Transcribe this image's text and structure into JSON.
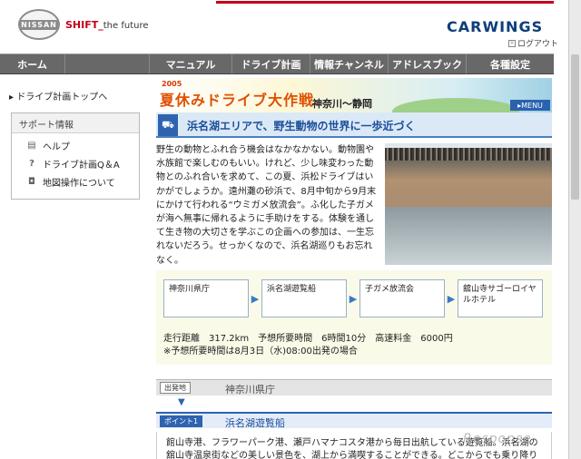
{
  "header": {
    "logo_text": "NISSAN",
    "tagline": "SHIFT_",
    "tagline_sub": "the future",
    "brand": "CARWINGS",
    "logout": "ログアウト",
    "accent_color": "#c4001a"
  },
  "nav": {
    "items": [
      "ホーム",
      "マニュアル",
      "ドライブ計画",
      "情報チャンネル",
      "アドレスブック",
      "各種設定"
    ]
  },
  "sidebar": {
    "top_link": "ドライブ計画トップへ",
    "support_title": "サポート情報",
    "support_items": [
      {
        "label": "ヘルプ",
        "icon": "document-icon"
      },
      {
        "label": "ドライブ計画Q＆A",
        "icon": "question-icon"
      },
      {
        "label": "地図操作について",
        "icon": "mouse-icon"
      }
    ]
  },
  "banner": {
    "year": "2005",
    "title": "夏休みドライブ大作戦",
    "route": "神奈川〜静岡",
    "menu": "MENU"
  },
  "section": {
    "heading": "浜名湖エリアで、野生動物の世界に一歩近づく",
    "body": "野生の動物とふれ合う機会はなかなかない。動物園や水族館で楽しむのもいい。けれど、少し味変わった動物とのふれ合いを求めて、この夏、浜松ドライブはいかがでしょうか。遠州灘の砂浜で、8月中旬から9月末にかけて行われる“ウミガメ放流会”。ふ化した子ガメが海へ無事に帰れるように手助けをする。体験を通して生き物の大切さを学ぶこの企画への参加は、一生忘れないだろう。せっかくなので、浜名湖巡りもお忘れなく。"
  },
  "route": {
    "stops": [
      "神奈川県庁",
      "浜名湖遊覧船",
      "子ガメ放流会",
      "舘山寺サゴーロイヤルホテル"
    ],
    "distance": "走行距離　317.2km　予想所要時間　6時間10分　高速料金　6000円",
    "note": "※予想所要時間は8月3日（水)08:00出発の場合"
  },
  "points": [
    {
      "tag": "出発地",
      "name": "神奈川県庁"
    },
    {
      "tag": "ポイント1",
      "name": "浜名湖遊覧船"
    }
  ],
  "detail": {
    "text": "館山寺港、フラワーパーク港、瀬戸ハマナコスタ港から毎日出航している遊覧船。浜名湖の舘山寺温泉街などの美しい景色を、湖上から満喫することができる。どこからでも乗り降りできる"
  },
  "watermark": "Response"
}
